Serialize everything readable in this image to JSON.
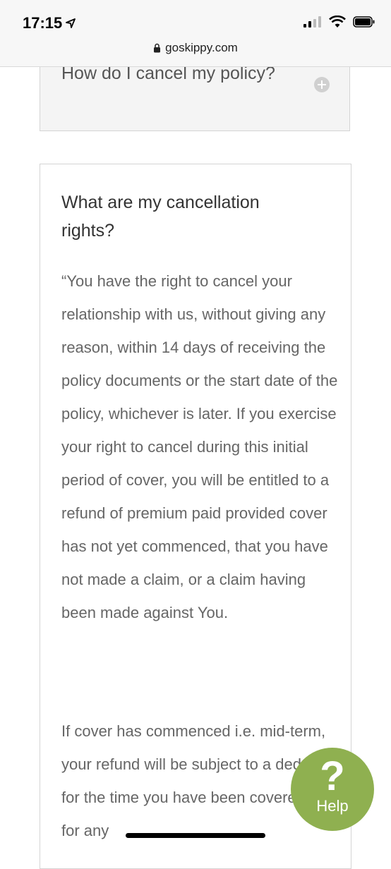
{
  "status_bar": {
    "time": "17:15"
  },
  "browser": {
    "url": "goskippy.com"
  },
  "faq": {
    "collapsed_question": "How do I cancel my policy?",
    "open_question": "What are my cancellation rights?",
    "answer_paragraphs": [
      "“You have the right to cancel your relationship with us, without giving any reason, within 14 days of receiving the policy documents or the start date of the policy, whichever is later. If you exercise your right to cancel during this initial period of cover, you will be entitled to a refund of premium paid provided cover has not yet commenced, that you have not made a claim, or a claim having been made against You.",
      "If cover has commenced i.e. mid-term, your refund will be subject to a deduction for the time you have been covered and for any"
    ]
  },
  "help_widget": {
    "icon": "?",
    "label": "Help",
    "color": "#8fb050"
  }
}
